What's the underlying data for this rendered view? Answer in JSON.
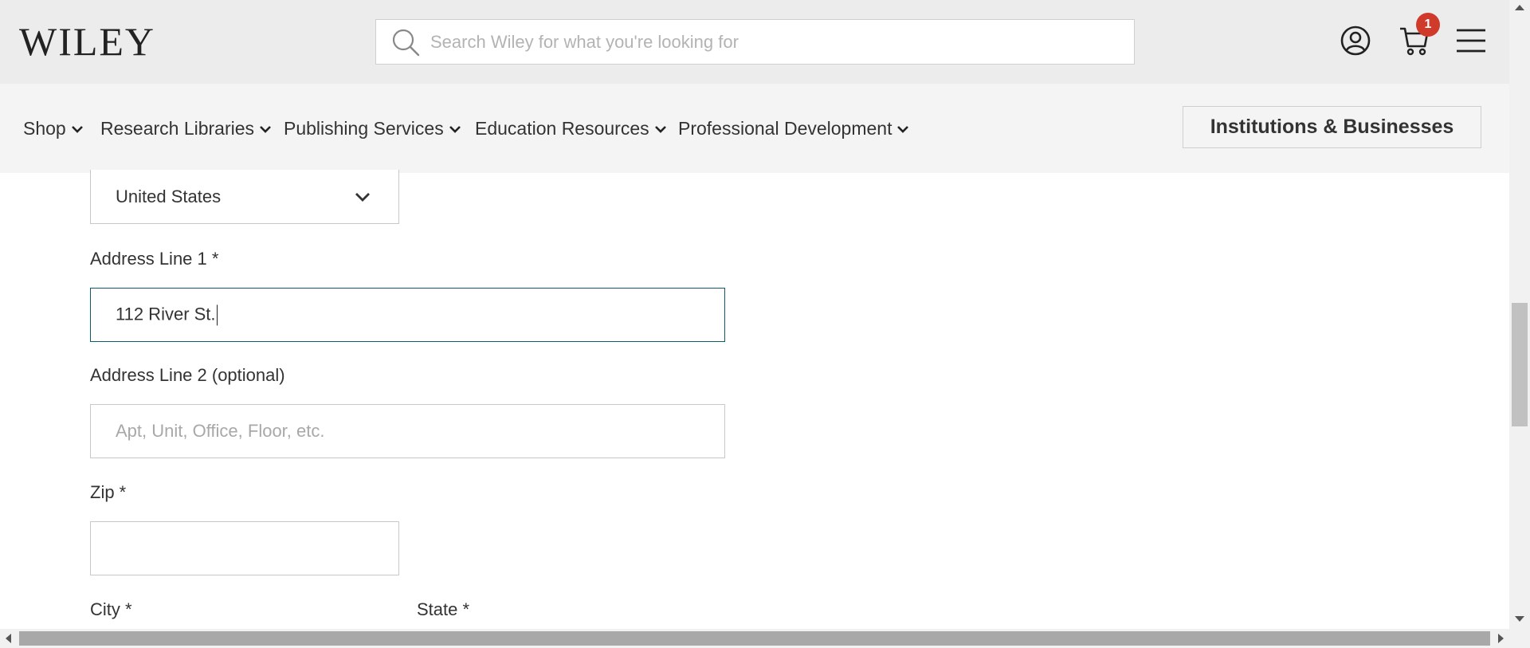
{
  "header": {
    "logo": "WILEY",
    "search_placeholder": "Search Wiley for what you're looking for",
    "cart_count": "1",
    "icons": [
      "search-icon",
      "account-icon",
      "cart-icon",
      "menu-icon"
    ]
  },
  "nav": {
    "items": [
      {
        "label": "Shop"
      },
      {
        "label": "Research Libraries"
      },
      {
        "label": "Publishing Services"
      },
      {
        "label": "Education Resources"
      },
      {
        "label": "Professional Development"
      }
    ],
    "institutions_button": "Institutions & Businesses"
  },
  "form": {
    "country_value": "United States",
    "address1_label": "Address Line 1 *",
    "address1_value": "112 River St.",
    "address2_label": "Address Line 2 (optional)",
    "address2_placeholder": "Apt, Unit, Office, Floor, etc.",
    "zip_label": "Zip *",
    "zip_value": "",
    "city_label": "City *",
    "state_label": "State *"
  },
  "colors": {
    "header_bg": "#ececec",
    "nav_bg": "#f4f4f4",
    "focus_border": "#0e5b6b",
    "badge": "#d03a2a"
  }
}
